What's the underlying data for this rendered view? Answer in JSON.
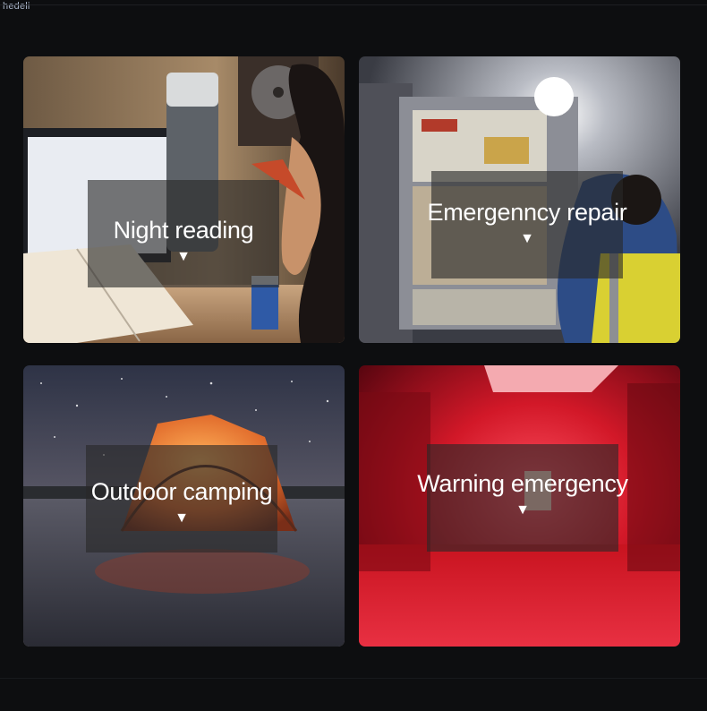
{
  "watermark": "hedeli",
  "tiles": [
    {
      "label": "Night reading"
    },
    {
      "label": "Emergenncy repair"
    },
    {
      "label": "Outdoor camping"
    },
    {
      "label": "Warning emergency"
    }
  ],
  "arrow_glyph": "▼"
}
